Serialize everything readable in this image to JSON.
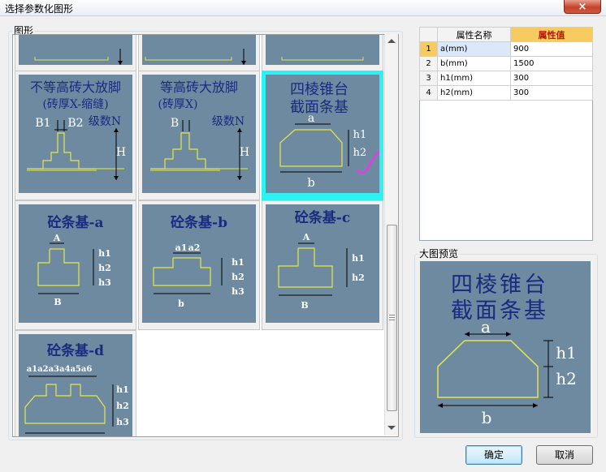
{
  "window": {
    "title": "选择参数化图形",
    "close_symbol": "×"
  },
  "groups": {
    "shapes": "图形",
    "preview": "大图预览"
  },
  "tiles": {
    "t4": {
      "title1": "不等高砖大放脚",
      "title2": "(砖厚X-缩缝)",
      "b1": "B1",
      "b2": "B2",
      "n": "级数N",
      "h": "H"
    },
    "t5": {
      "title1": "等高砖大放脚",
      "title2": "(砖厚X)",
      "b": "B",
      "n": "级数N",
      "h": "H"
    },
    "t6": {
      "title1": "四棱锥台",
      "title2": "截面条基",
      "a": "a",
      "h1": "h1",
      "h2": "h2",
      "b": "b"
    },
    "t7": {
      "title": "砼条基-a",
      "a": "A",
      "h1": "h1",
      "h2": "h2",
      "h3": "h3",
      "b": "B"
    },
    "t8": {
      "title": "砼条基-b",
      "a1": "a1",
      "a2": "a2",
      "h1": "h1",
      "h2": "h2",
      "h3": "h3",
      "b": "b"
    },
    "t9": {
      "title": "砼条基-c",
      "a": "A",
      "h1": "h1",
      "h2": "h2",
      "b": "B"
    },
    "t10": {
      "title": "砼条基-d",
      "a": "a1a2a3a4a5a6",
      "h1": "h1",
      "h2": "h2",
      "h3": "h3"
    }
  },
  "table": {
    "headers": [
      "属性名称",
      "属性值"
    ],
    "rows": [
      {
        "n": "1",
        "name": "a(mm)",
        "value": "900"
      },
      {
        "n": "2",
        "name": "b(mm)",
        "value": "1500"
      },
      {
        "n": "3",
        "name": "h1(mm)",
        "value": "300"
      },
      {
        "n": "4",
        "name": "h2(mm)",
        "value": "300"
      }
    ]
  },
  "preview": {
    "title1": "四棱锥台",
    "title2": "截面条基",
    "a": "a",
    "h1": "h1",
    "h2": "h2",
    "b": "b"
  },
  "buttons": {
    "ok": "确定",
    "cancel": "取消"
  }
}
